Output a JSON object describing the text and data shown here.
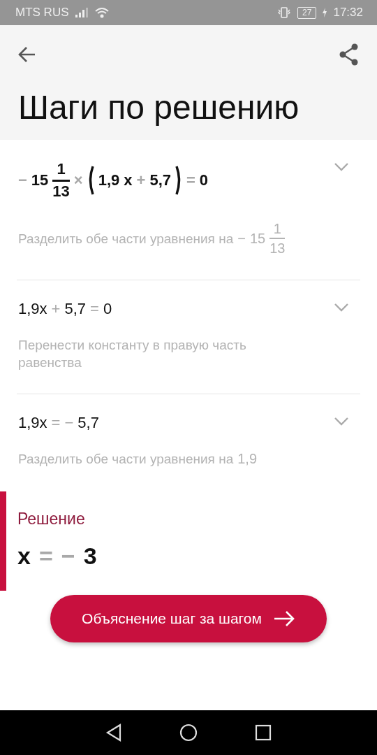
{
  "status_bar": {
    "carrier": "MTS RUS",
    "battery": "27",
    "time": "17:32"
  },
  "header": {
    "title": "Шаги по решению"
  },
  "steps": [
    {
      "expanded": false,
      "bold": true,
      "equation": [
        {
          "kind": "op",
          "text": "−"
        },
        {
          "kind": "frac",
          "whole": "15",
          "num": "1",
          "den": "13"
        },
        {
          "kind": "op",
          "text": "×"
        },
        {
          "kind": "paren",
          "children": [
            {
              "kind": "term",
              "text": "1,9"
            },
            {
              "kind": "term",
              "text": "x"
            },
            {
              "kind": "op",
              "text": "+"
            },
            {
              "kind": "term",
              "text": "5,7"
            }
          ]
        },
        {
          "kind": "op",
          "text": "="
        },
        {
          "kind": "term",
          "text": "0"
        }
      ],
      "description": {
        "text": "Разделить обе части уравнения на",
        "math": [
          {
            "kind": "op",
            "text": "−"
          },
          {
            "kind": "frac",
            "whole": "15",
            "num": "1",
            "den": "13"
          }
        ]
      }
    },
    {
      "expanded": false,
      "bold": false,
      "equation": [
        {
          "kind": "term",
          "text": "1,9x"
        },
        {
          "kind": "op",
          "text": "+"
        },
        {
          "kind": "term",
          "text": "5,7"
        },
        {
          "kind": "op",
          "text": "="
        },
        {
          "kind": "term",
          "text": "0"
        }
      ],
      "description": {
        "text": "Перенести константу в правую часть равенства"
      }
    },
    {
      "expanded": false,
      "bold": false,
      "equation": [
        {
          "kind": "term",
          "text": "1,9x"
        },
        {
          "kind": "op",
          "text": "="
        },
        {
          "kind": "op",
          "text": "−"
        },
        {
          "kind": "term",
          "text": "5,7"
        }
      ],
      "description": {
        "text": "Разделить обе части уравнения на",
        "math": [
          {
            "kind": "term",
            "text": "1,9"
          }
        ]
      }
    }
  ],
  "solution": {
    "label": "Решение",
    "equation": [
      {
        "kind": "term",
        "text": "x"
      },
      {
        "kind": "op",
        "text": "="
      },
      {
        "kind": "op",
        "text": "−"
      },
      {
        "kind": "term",
        "text": "3"
      }
    ]
  },
  "button": {
    "label": "Объяснение шаг за шагом"
  }
}
